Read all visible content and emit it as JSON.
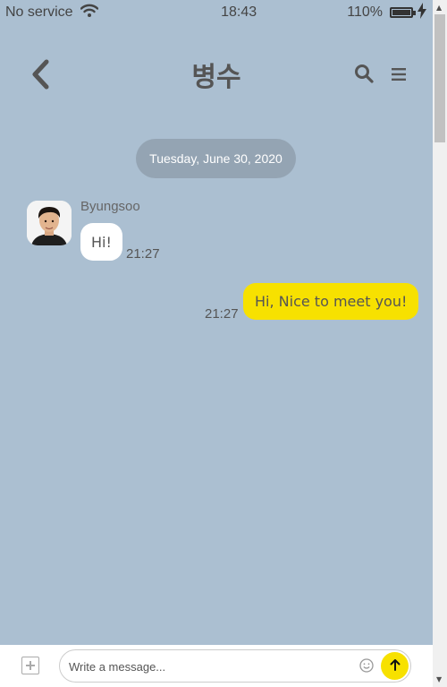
{
  "status_bar": {
    "carrier": "No service",
    "time": "18:43",
    "battery": "110%"
  },
  "header": {
    "title": "병수",
    "back_icon": "chevron-left-icon",
    "search_icon": "search-icon",
    "menu_icon": "menu-icon"
  },
  "chat": {
    "date_divider": "Tuesday, June 30, 2020",
    "messages": [
      {
        "direction": "incoming",
        "sender": "Byungsoo",
        "text": "Hi!",
        "time": "21:27"
      },
      {
        "direction": "outgoing",
        "text": "Hi, Nice to meet you!",
        "time": "21:27"
      }
    ]
  },
  "composer": {
    "placeholder": "Write a message...",
    "value": "",
    "plus_icon": "plus-square-icon",
    "emoji_icon": "smiley-icon",
    "send_icon": "arrow-up-icon"
  },
  "colors": {
    "background": "#abbfd1",
    "date_pill": "#94a4b3",
    "outgoing_bubble": "#f7e100",
    "incoming_bubble": "#ffffff",
    "send_button": "#f7e100"
  }
}
